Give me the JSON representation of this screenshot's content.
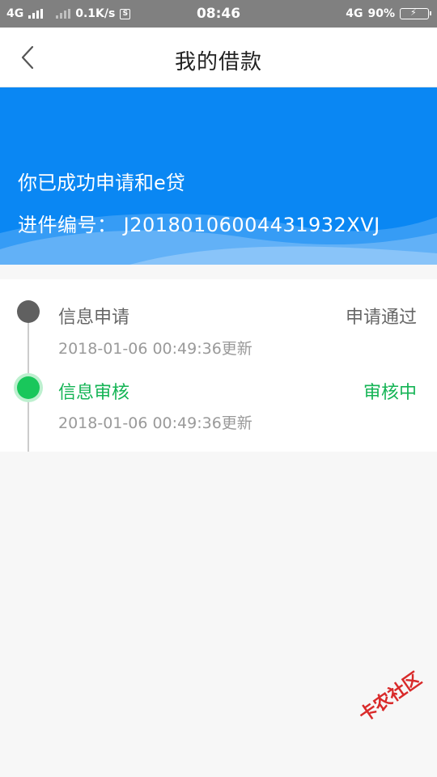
{
  "status_bar": {
    "network1": "4G",
    "speed": "0.1K/s",
    "speed_icon": "S",
    "time": "08:46",
    "network2": "4G",
    "battery": "90%",
    "battery_level": 0.9
  },
  "nav": {
    "title": "我的借款",
    "back_icon": "chevron-left-icon"
  },
  "banner": {
    "title": "你已成功申请和e贷",
    "number": "进件编号：  J20180106004431932XVJ",
    "bg_color": "#0a87f3"
  },
  "steps": [
    {
      "title": "信息申请",
      "status": "申请通过",
      "time": "2018-01-06 00:49:36更新",
      "state": "done"
    },
    {
      "title": "信息审核",
      "status": "审核中",
      "time": "2018-01-06 00:49:36更新",
      "state": "active"
    }
  ],
  "colors": {
    "active_green": "#14b455",
    "done_gray": "#606060"
  },
  "watermark": {
    "text": "卡农社区"
  }
}
